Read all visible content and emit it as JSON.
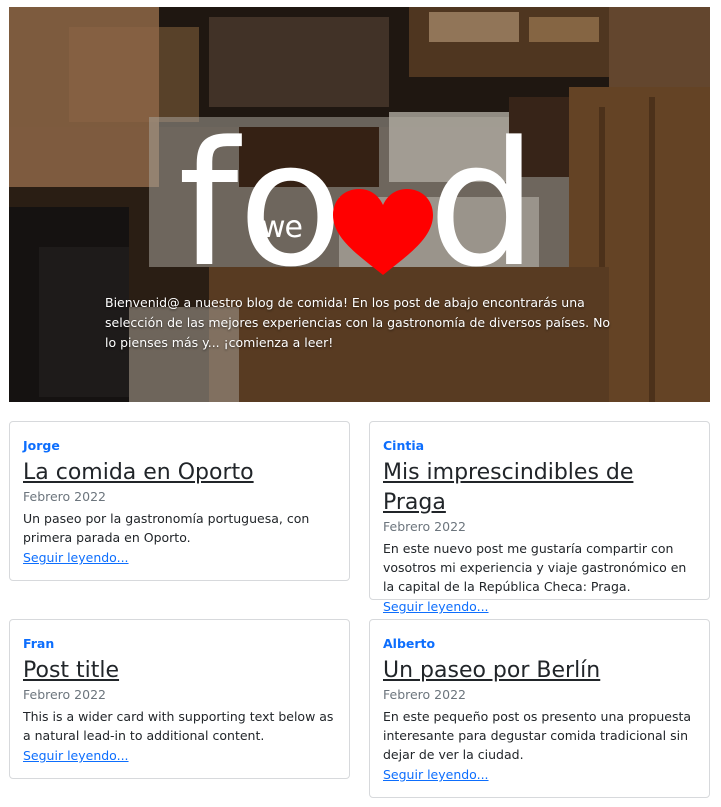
{
  "hero": {
    "logo_f": "f",
    "logo_o": "o",
    "logo_we": "we",
    "logo_d": "d",
    "intro": "Bienvenid@ a nuestro blog de comida! En los post de abajo encontrarás una selección de las mejores experiencias con la gastronomía de diversos países. No lo pienses más y... ¡comienza a leer!",
    "heart_color": "#ff0000"
  },
  "cards": [
    {
      "author": "Jorge",
      "title": "La comida en Oporto",
      "date": "Febrero 2022",
      "text": "Un paseo por la gastronomía portuguesa, con primera parada en Oporto.",
      "link": "Seguir leyendo..."
    },
    {
      "author": "Cintia",
      "title": "Mis imprescindibles de Praga",
      "date": "Febrero 2022",
      "text": "En este nuevo post me gustaría compartir con vosotros mi experiencia y viaje gastronómico en la capital de la República Checa: Praga.",
      "link": "Seguir leyendo..."
    },
    {
      "author": "Fran",
      "title": "Post title",
      "date": "Febrero 2022",
      "text": "This is a wider card with supporting text below as a natural lead-in to additional content.",
      "link": "Seguir leyendo..."
    },
    {
      "author": "Alberto",
      "title": "Un paseo por Berlín",
      "date": "Febrero 2022",
      "text": "En este pequeño post os presento una propuesta interesante para degustar comida tradicional sin dejar de ver la ciudad.",
      "link": "Seguir leyendo..."
    }
  ],
  "colors": {
    "accent": "#0d6efd",
    "muted": "#6c757d",
    "border": "#d7d9dc"
  }
}
